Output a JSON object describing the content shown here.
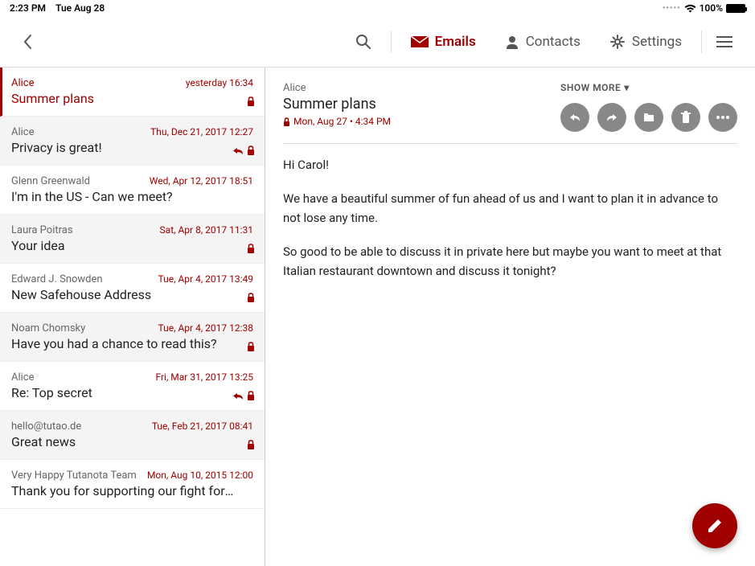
{
  "statusbar": {
    "time": "2:23 PM",
    "date": "Tue Aug 28",
    "battery_pct": "100%"
  },
  "nav": {
    "emails": "Emails",
    "contacts": "Contacts",
    "settings": "Settings"
  },
  "mails": [
    {
      "sender": "Alice",
      "date": "yesterday 16:34",
      "subject": "Summer plans",
      "lock": true,
      "reply": false,
      "selected": true,
      "alt": false
    },
    {
      "sender": "Alice",
      "date": "Thu, Dec 21, 2017 12:27",
      "subject": "Privacy is great!",
      "lock": true,
      "reply": true,
      "selected": false,
      "alt": true
    },
    {
      "sender": "Glenn Greenwald",
      "date": "Wed, Apr 12, 2017 18:51",
      "subject": "I'm in the US - Can we meet?",
      "lock": false,
      "reply": false,
      "selected": false,
      "alt": false
    },
    {
      "sender": "Laura Poitras",
      "date": "Sat, Apr 8, 2017 11:31",
      "subject": "Your idea",
      "lock": true,
      "reply": false,
      "selected": false,
      "alt": true
    },
    {
      "sender": "Edward J. Snowden",
      "date": "Tue, Apr 4, 2017 13:49",
      "subject": "New Safehouse Address",
      "lock": true,
      "reply": false,
      "selected": false,
      "alt": false
    },
    {
      "sender": "Noam Chomsky",
      "date": "Tue, Apr 4, 2017 12:38",
      "subject": "Have you had a chance to read this?",
      "lock": true,
      "reply": false,
      "selected": false,
      "alt": true
    },
    {
      "sender": "Alice",
      "date": "Fri, Mar 31, 2017 13:25",
      "subject": "Re: Top secret",
      "lock": true,
      "reply": true,
      "selected": false,
      "alt": false
    },
    {
      "sender": "hello@tutao.de",
      "date": "Tue, Feb 21, 2017 08:41",
      "subject": "Great news",
      "lock": true,
      "reply": false,
      "selected": false,
      "alt": true
    },
    {
      "sender": "Very Happy Tutanota Team",
      "date": "Mon, Aug 10, 2015 12:00",
      "subject": "Thank you for supporting our fight for priv…",
      "lock": false,
      "reply": false,
      "selected": false,
      "alt": false
    }
  ],
  "detail": {
    "from": "Alice",
    "subject": "Summer plans",
    "meta": "Mon, Aug 27 • 4:34 PM",
    "show_more": "SHOW MORE",
    "body": [
      "Hi Carol!",
      "We have a beautiful summer of fun ahead of us and I want to plan it in advance to not lose any time.",
      "So good to be able to discuss it in private here but maybe you want to meet at that Italian restaurant downtown and discuss it tonight?"
    ]
  }
}
